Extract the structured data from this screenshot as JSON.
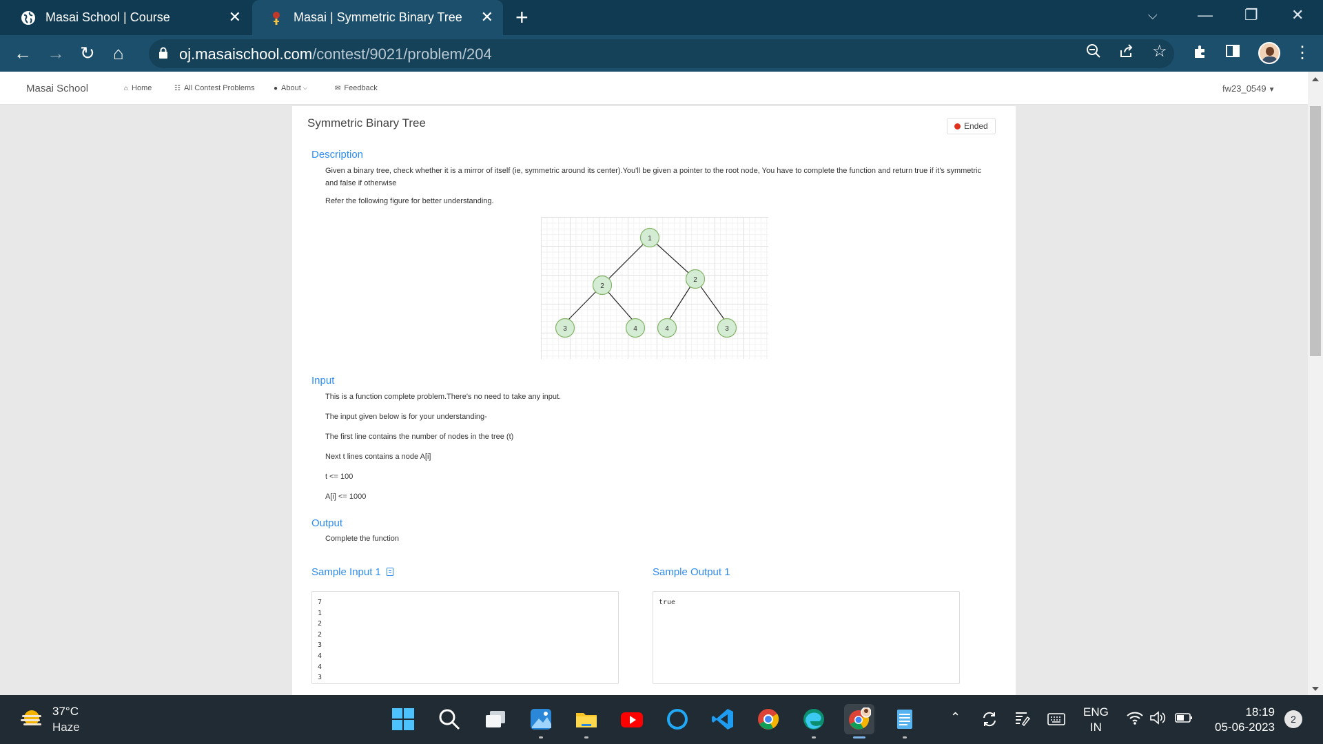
{
  "browser": {
    "tabs": [
      {
        "title": "Masai School | Course",
        "icon": "globe-icon",
        "active": false
      },
      {
        "title": "Masai | Symmetric Binary Tree",
        "icon": "masai-favicon",
        "active": true
      }
    ],
    "url_host": "oj.masaischool.com",
    "url_path": "/contest/9021/problem/204"
  },
  "site": {
    "brand": "Masai School",
    "nav": [
      {
        "label": "Home",
        "icon": "home-icon"
      },
      {
        "label": "All Contest Problems",
        "icon": "grid-icon"
      },
      {
        "label": "About",
        "icon": "info-icon"
      },
      {
        "label": "Feedback",
        "icon": "feedback-icon"
      }
    ],
    "user": "fw23_0549"
  },
  "problem": {
    "title": "Symmetric Binary Tree",
    "status": "Ended",
    "description_title": "Description",
    "description": "Given a binary tree, check whether it is a mirror of itself (ie, symmetric around its center).You'll be given a pointer to the root node, You have to complete the function and return true if it's symmetric and false if otherwise",
    "figure_caption": "Refer the following figure for better understanding.",
    "tree": {
      "root": "1",
      "level2": [
        "2",
        "2"
      ],
      "level3": [
        "3",
        "4",
        "4",
        "3"
      ]
    },
    "input_title": "Input",
    "input_lines": [
      "This is a function complete problem.There's no need to take any input.",
      "The input given below is for your understanding-",
      "The first line contains the number of nodes in the tree (t)",
      "Next t lines contains a node A[i]",
      "t <= 100",
      "A[i] <= 1000"
    ],
    "output_title": "Output",
    "output_text": "Complete the function",
    "sample_input_label": "Sample Input 1",
    "sample_output_label": "Sample Output 1",
    "sample_input": "7\n1\n2\n2\n3\n4\n4\n3",
    "sample_output": "true"
  },
  "taskbar": {
    "temperature": "37°C",
    "weather": "Haze",
    "language_top": "ENG",
    "language_bottom": "IN",
    "time": "18:19",
    "date": "05-06-2023",
    "notifications": "2"
  },
  "colors": {
    "accent": "#2d8cf0",
    "tabstrip": "#0f3a52",
    "toolbar": "#1c4f6b",
    "status_dot": "#e0301e",
    "node_fill": "#d5ecd4",
    "node_stroke": "#82b366"
  }
}
